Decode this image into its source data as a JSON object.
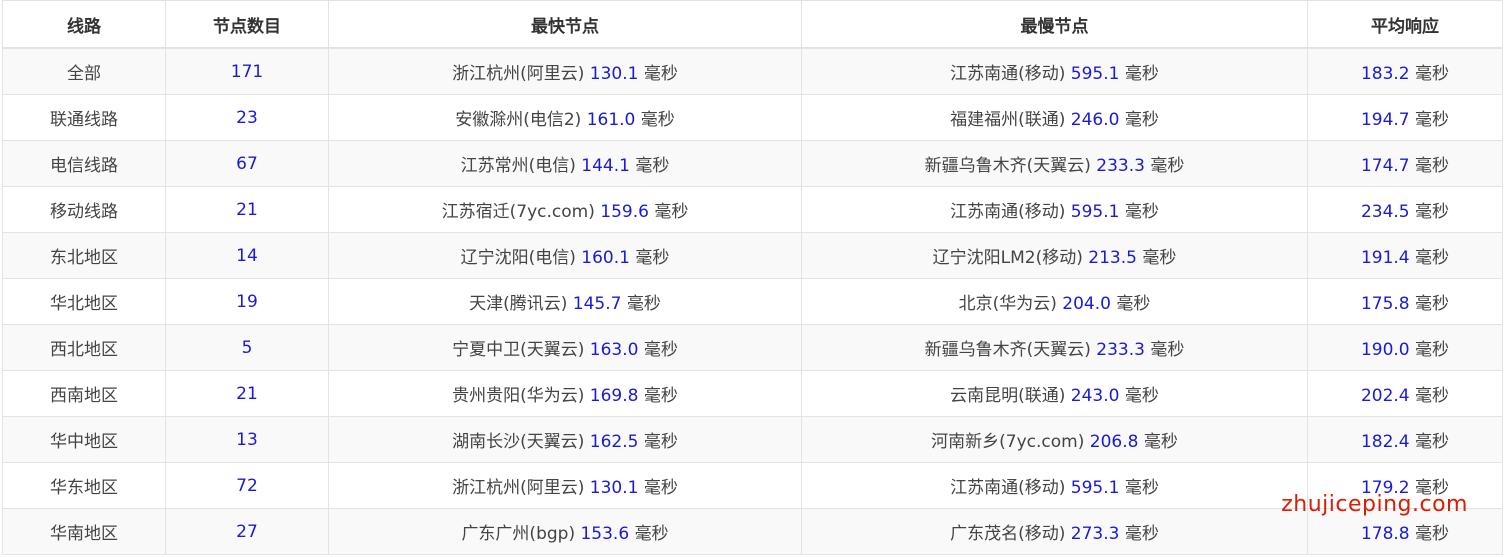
{
  "table": {
    "headers": [
      "线路",
      "节点数目",
      "最快节点",
      "最慢节点",
      "平均响应"
    ],
    "rows": [
      {
        "route": "全部",
        "count": "171",
        "fast_name": "浙江杭州(阿里云)",
        "fast_ms": "130.1",
        "slow_name": "江苏南通(移动)",
        "slow_ms": "595.1",
        "avg_ms": "183.2"
      },
      {
        "route": "联通线路",
        "count": "23",
        "fast_name": "安徽滁州(电信2)",
        "fast_ms": "161.0",
        "slow_name": "福建福州(联通)",
        "slow_ms": "246.0",
        "avg_ms": "194.7"
      },
      {
        "route": "电信线路",
        "count": "67",
        "fast_name": "江苏常州(电信)",
        "fast_ms": "144.1",
        "slow_name": "新疆乌鲁木齐(天翼云)",
        "slow_ms": "233.3",
        "avg_ms": "174.7"
      },
      {
        "route": "移动线路",
        "count": "21",
        "fast_name": "江苏宿迁(7yc.com)",
        "fast_ms": "159.6",
        "slow_name": "江苏南通(移动)",
        "slow_ms": "595.1",
        "avg_ms": "234.5"
      },
      {
        "route": "东北地区",
        "count": "14",
        "fast_name": "辽宁沈阳(电信)",
        "fast_ms": "160.1",
        "slow_name": "辽宁沈阳LM2(移动)",
        "slow_ms": "213.5",
        "avg_ms": "191.4"
      },
      {
        "route": "华北地区",
        "count": "19",
        "fast_name": "天津(腾讯云)",
        "fast_ms": "145.7",
        "slow_name": "北京(华为云)",
        "slow_ms": "204.0",
        "avg_ms": "175.8"
      },
      {
        "route": "西北地区",
        "count": "5",
        "fast_name": "宁夏中卫(天翼云)",
        "fast_ms": "163.0",
        "slow_name": "新疆乌鲁木齐(天翼云)",
        "slow_ms": "233.3",
        "avg_ms": "190.0"
      },
      {
        "route": "西南地区",
        "count": "21",
        "fast_name": "贵州贵阳(华为云)",
        "fast_ms": "169.8",
        "slow_name": "云南昆明(联通)",
        "slow_ms": "243.0",
        "avg_ms": "202.4"
      },
      {
        "route": "华中地区",
        "count": "13",
        "fast_name": "湖南长沙(天翼云)",
        "fast_ms": "162.5",
        "slow_name": "河南新乡(7yc.com)",
        "slow_ms": "206.8",
        "avg_ms": "182.4"
      },
      {
        "route": "华东地区",
        "count": "72",
        "fast_name": "浙江杭州(阿里云)",
        "fast_ms": "130.1",
        "slow_name": "江苏南通(移动)",
        "slow_ms": "595.1",
        "avg_ms": "179.2"
      },
      {
        "route": "华南地区",
        "count": "27",
        "fast_name": "广东广州(bgp)",
        "fast_ms": "153.6",
        "slow_name": "广东茂名(移动)",
        "slow_ms": "273.3",
        "avg_ms": "178.8"
      }
    ]
  },
  "unit_label": "毫秒",
  "watermark": "zhujiceping.com",
  "colors": {
    "number": "#1a1ad8",
    "text": "#444444",
    "header": "#333333",
    "border": "#e3e3e3",
    "stripe": "#f9f9f9",
    "watermark": "#d81e06"
  }
}
